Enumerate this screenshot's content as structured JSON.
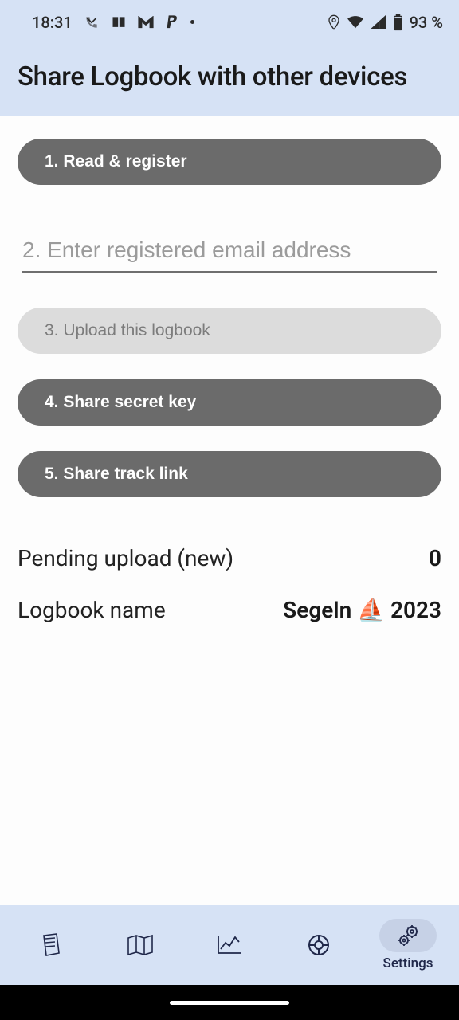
{
  "status": {
    "time": "18:31",
    "battery": "93 %"
  },
  "header": {
    "title": "Share Logbook with other devices"
  },
  "steps": {
    "read_register": "1. Read & register",
    "email_placeholder": "2. Enter registered email address",
    "upload": "3. Upload this logbook",
    "share_key": "4. Share secret key",
    "share_track": "5. Share track link"
  },
  "info": {
    "pending_label": "Pending upload (new)",
    "pending_value": "0",
    "name_label": "Logbook name",
    "name_value": "Segeln ⛵ 2023"
  },
  "nav": {
    "settings": "Settings"
  }
}
